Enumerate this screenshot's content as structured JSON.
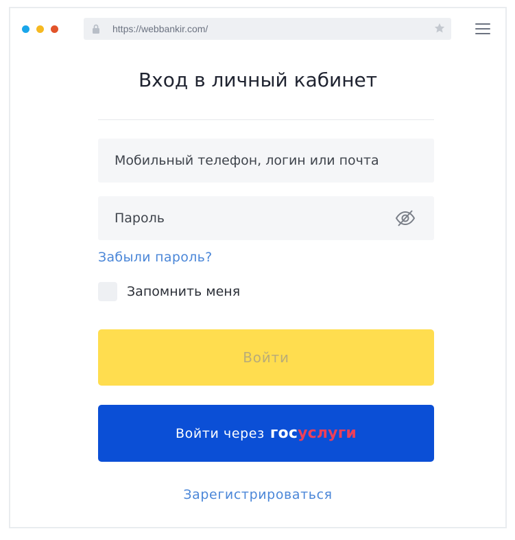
{
  "browser": {
    "url": "https://webbankir.com/",
    "icons": {
      "lock": "lock-icon",
      "star": "star-icon",
      "menu": "hamburger-menu-icon"
    },
    "dot_colors": [
      "#1aa6ea",
      "#f6b921",
      "#e2542a"
    ]
  },
  "login": {
    "title": "Вход в личный кабинет",
    "login_placeholder": "Мобильный телефон, логин или почта",
    "password_placeholder": "Пароль",
    "forgot_password": "Забыли пароль?",
    "remember_me": "Запомнить меня",
    "login_button": "Войти",
    "gos_button_prefix": "Войти через",
    "gos_logo_part1": "гос",
    "gos_logo_part2": "услуги",
    "register": "Зарегистрироваться"
  },
  "colors": {
    "accent_yellow": "#ffdd4f",
    "accent_blue": "#0b4fd6",
    "link_blue": "#4a86d8",
    "gos_red": "#ee3f58"
  }
}
